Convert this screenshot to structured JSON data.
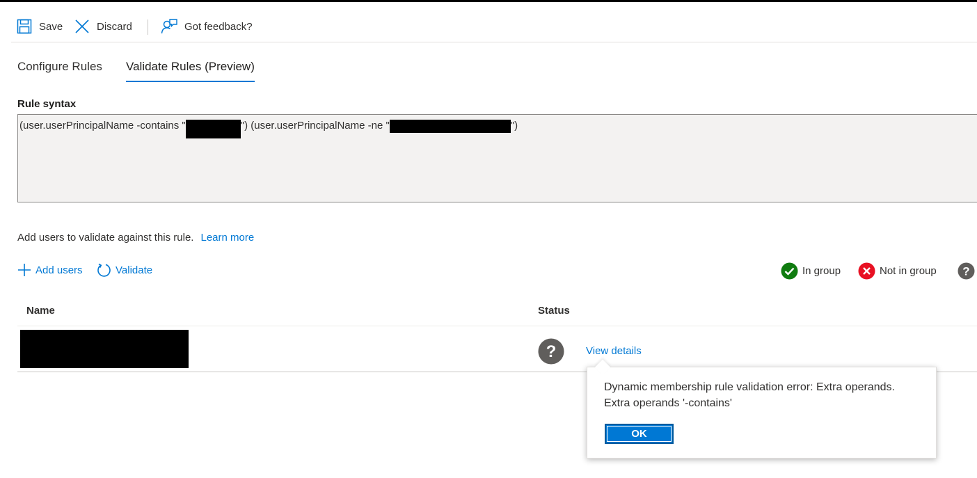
{
  "toolbar": {
    "save_label": "Save",
    "discard_label": "Discard",
    "feedback_label": "Got feedback?"
  },
  "tabs": [
    {
      "label": "Configure Rules",
      "active": false
    },
    {
      "label": "Validate Rules (Preview)",
      "active": true
    }
  ],
  "rule": {
    "label": "Rule syntax",
    "part1": "(user.userPrincipalName -contains \"",
    "part2": "\") (user.userPrincipalName -ne \"",
    "part3": "\")"
  },
  "validate": {
    "instruction": "Add users to validate against this rule.",
    "learn_more": "Learn more",
    "add_users": "Add users",
    "validate": "Validate"
  },
  "legend": {
    "in_group": "In group",
    "not_in_group": "Not in group"
  },
  "table": {
    "headers": {
      "name": "Name",
      "status": "Status"
    },
    "rows": [
      {
        "status_icon": "question-icon",
        "action": "View details"
      }
    ]
  },
  "dialog": {
    "line1": "Dynamic membership rule validation error: Extra operands.",
    "line2": "Extra operands '-contains'",
    "ok": "OK"
  },
  "colors": {
    "accent": "#0078d4",
    "success": "#107c10",
    "error": "#e81123",
    "unknown": "#605e5c"
  }
}
